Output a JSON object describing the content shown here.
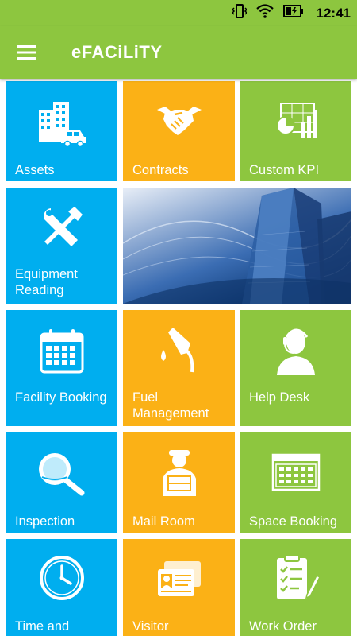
{
  "status_bar": {
    "time": "12:41",
    "icons": [
      "vibrate-icon",
      "wifi-icon",
      "battery-icon"
    ]
  },
  "app_bar": {
    "title": "eFACiLiTY",
    "menu_icon": "hamburger-menu-icon"
  },
  "colors": {
    "green": "#8dc63f",
    "blue": "#00aeef",
    "orange": "#fbb116"
  },
  "tiles": [
    {
      "label": "Assets",
      "icon": "buildings-car-icon",
      "color": "blue"
    },
    {
      "label": "Contracts",
      "icon": "handshake-icon",
      "color": "orange"
    },
    {
      "label": "Custom KPI",
      "icon": "kpi-chart-icon",
      "color": "green"
    },
    {
      "label": "Equipment Reading",
      "icon": "wrench-hammer-icon",
      "color": "blue"
    },
    {
      "label": "Facility Booking",
      "icon": "calendar-icon",
      "color": "blue"
    },
    {
      "label": "Fuel Management",
      "icon": "fuel-nozzle-icon",
      "color": "orange"
    },
    {
      "label": "Help Desk",
      "icon": "support-agent-icon",
      "color": "green"
    },
    {
      "label": "Inspection",
      "icon": "magnifier-icon",
      "color": "blue"
    },
    {
      "label": "Mail Room",
      "icon": "delivery-person-icon",
      "color": "orange"
    },
    {
      "label": "Space Booking",
      "icon": "floor-plan-icon",
      "color": "green"
    },
    {
      "label": "Time and",
      "icon": "clock-icon",
      "color": "blue"
    },
    {
      "label": "Visitor",
      "icon": "id-card-icon",
      "color": "orange"
    },
    {
      "label": "Work Order",
      "icon": "checklist-icon",
      "color": "green"
    }
  ]
}
